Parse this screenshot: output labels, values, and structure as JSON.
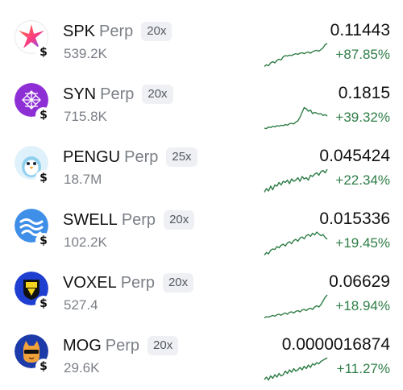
{
  "colors": {
    "positive": "#2e7d46",
    "muted": "#7b7f86",
    "badge_bg": "#eef0f3"
  },
  "markets": [
    {
      "symbol": "SPK",
      "suffix": "Perp",
      "leverage": "20x",
      "volume": "539.2K",
      "price": "0.11443",
      "change": "+87.85%",
      "icon": "spk-star-icon",
      "quote_icon": "dollar-icon",
      "spark": [
        0.05,
        0.12,
        0.08,
        0.2,
        0.25,
        0.2,
        0.3,
        0.35,
        0.32,
        0.45,
        0.5,
        0.48,
        0.52,
        0.5,
        0.55,
        0.58,
        0.55,
        0.6,
        0.62,
        0.58,
        0.62,
        0.65,
        0.6,
        0.66,
        0.7,
        0.72,
        0.68,
        0.75,
        0.82,
        0.95,
        1.0
      ]
    },
    {
      "symbol": "SYN",
      "suffix": "Perp",
      "leverage": "20x",
      "volume": "715.8K",
      "price": "0.1815",
      "change": "+39.32%",
      "icon": "syn-grid-icon",
      "quote_icon": "dollar-icon",
      "spark": [
        0.1,
        0.08,
        0.15,
        0.12,
        0.18,
        0.15,
        0.2,
        0.18,
        0.22,
        0.2,
        0.25,
        0.22,
        0.28,
        0.3,
        0.27,
        0.35,
        0.4,
        0.55,
        0.75,
        0.95,
        0.9,
        0.8,
        0.85,
        0.7,
        0.75,
        0.72,
        0.68,
        0.7,
        0.62,
        0.66,
        0.6
      ]
    },
    {
      "symbol": "PENGU",
      "suffix": "Perp",
      "leverage": "25x",
      "volume": "18.7M",
      "price": "0.045424",
      "change": "+22.34%",
      "icon": "pengu-penguin-icon",
      "quote_icon": "dollar-icon",
      "spark": [
        0.05,
        0.2,
        0.1,
        0.3,
        0.15,
        0.35,
        0.3,
        0.45,
        0.35,
        0.5,
        0.45,
        0.55,
        0.4,
        0.6,
        0.5,
        0.55,
        0.65,
        0.5,
        0.7,
        0.6,
        0.65,
        0.55,
        0.75,
        0.7,
        0.8,
        0.85,
        0.75,
        0.9,
        0.95,
        0.85,
        1.0
      ]
    },
    {
      "symbol": "SWELL",
      "suffix": "Perp",
      "leverage": "20x",
      "volume": "102.2K",
      "price": "0.015336",
      "change": "+19.45%",
      "icon": "swell-wave-icon",
      "quote_icon": "dollar-icon",
      "spark": [
        0.05,
        0.15,
        0.1,
        0.25,
        0.3,
        0.28,
        0.4,
        0.35,
        0.45,
        0.5,
        0.42,
        0.55,
        0.6,
        0.52,
        0.65,
        0.7,
        0.62,
        0.75,
        0.8,
        0.72,
        0.85,
        0.9,
        0.82,
        0.95,
        0.88,
        1.0,
        0.92,
        0.85,
        0.9,
        0.78,
        0.7
      ]
    },
    {
      "symbol": "VOXEL",
      "suffix": "Perp",
      "leverage": "20x",
      "volume": "527.4",
      "price": "0.06629",
      "change": "+18.94%",
      "icon": "voxel-shield-icon",
      "quote_icon": "dollar-icon",
      "spark": [
        0.05,
        0.1,
        0.08,
        0.12,
        0.15,
        0.12,
        0.18,
        0.2,
        0.16,
        0.22,
        0.25,
        0.2,
        0.28,
        0.3,
        0.25,
        0.32,
        0.35,
        0.3,
        0.38,
        0.4,
        0.35,
        0.42,
        0.45,
        0.4,
        0.5,
        0.55,
        0.5,
        0.6,
        0.75,
        0.9,
        1.0
      ]
    },
    {
      "symbol": "MOG",
      "suffix": "Perp",
      "leverage": "20x",
      "volume": "29.6K",
      "price": "0.0000016874",
      "change": "+11.27%",
      "icon": "mog-cat-icon",
      "quote_icon": "dollar-icon",
      "spark": [
        0.1,
        0.2,
        0.08,
        0.25,
        0.15,
        0.3,
        0.2,
        0.35,
        0.25,
        0.3,
        0.45,
        0.35,
        0.5,
        0.4,
        0.55,
        0.45,
        0.5,
        0.6,
        0.5,
        0.65,
        0.55,
        0.7,
        0.6,
        0.75,
        0.7,
        0.8,
        0.75,
        0.85,
        0.9,
        0.95,
        1.0
      ]
    }
  ]
}
